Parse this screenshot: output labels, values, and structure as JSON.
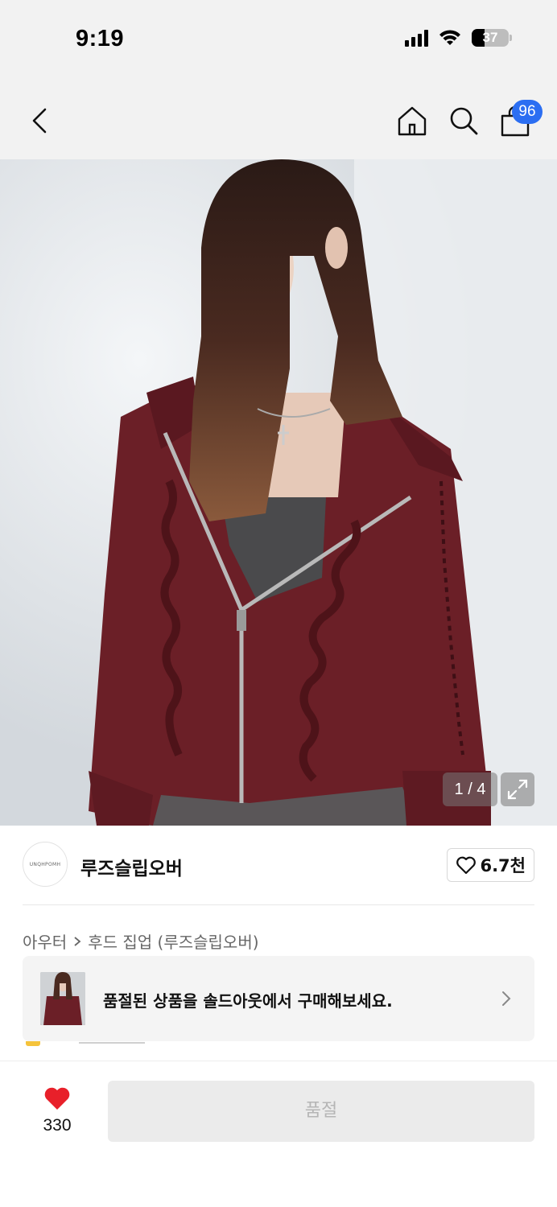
{
  "status_bar": {
    "time": "9:19",
    "battery": "37"
  },
  "nav": {
    "cart_count": "96"
  },
  "hero": {
    "counter": "1 / 4"
  },
  "brand": {
    "logo_text": "UNQHPOMH",
    "name": "루즈슬립오버",
    "like_count": "6.7천"
  },
  "breadcrumb": {
    "category": "아우터",
    "subcategory": "후드 집업 (루즈슬립오버)"
  },
  "soldout_banner": {
    "text": "품절된 상품을 솔드아웃에서 구매해보세요."
  },
  "bottom_bar": {
    "wish_count": "330",
    "soldout_label": "품절"
  },
  "colors": {
    "accent_blue": "#2b6ef2",
    "heart_red": "#e8202a",
    "hoodie_burgundy": "#6b1f27"
  }
}
